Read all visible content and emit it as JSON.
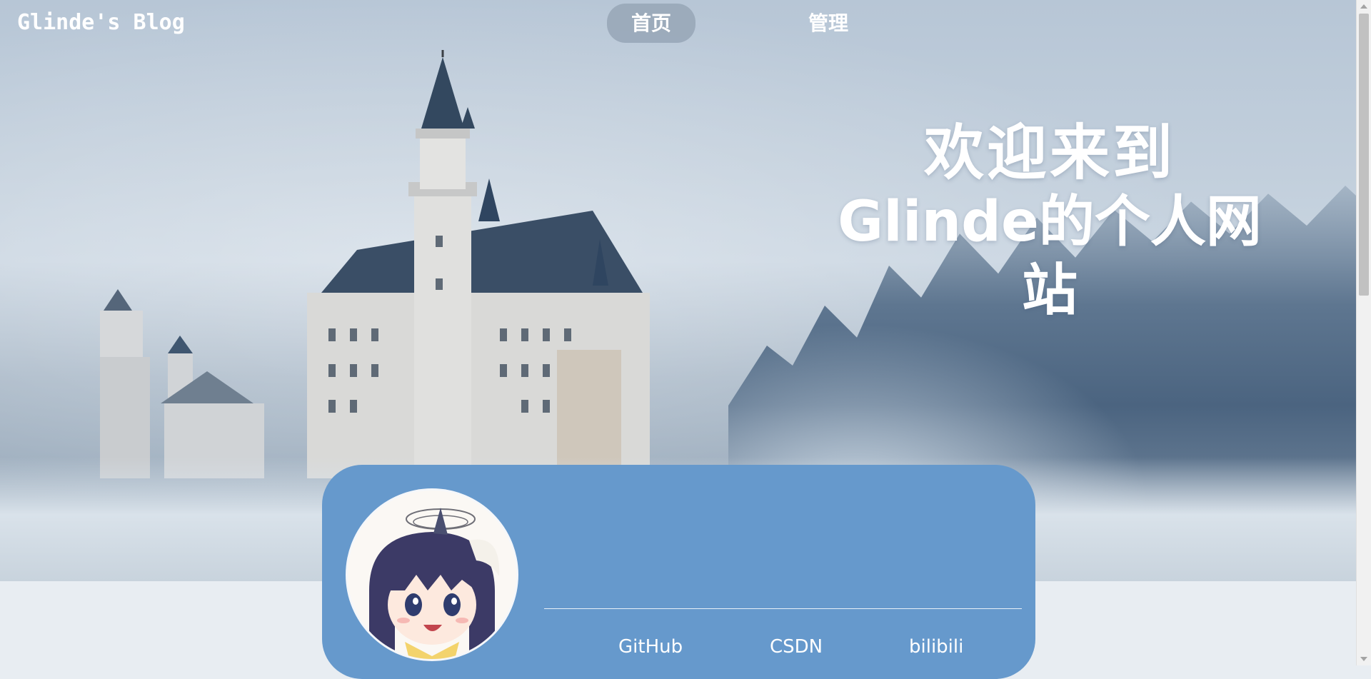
{
  "header": {
    "logo_text": "Glinde's Blog",
    "nav": [
      {
        "label": "首页",
        "active": true
      },
      {
        "label": "管理",
        "active": false
      }
    ]
  },
  "hero": {
    "welcome_line1": "欢迎来到",
    "welcome_line2": "Glinde的个人网站",
    "background_image": "winter-castle-forest"
  },
  "profile_card": {
    "avatar_icon": "anime-girl-avatar",
    "links": [
      {
        "label": "GitHub"
      },
      {
        "label": "CSDN"
      },
      {
        "label": "bilibili"
      }
    ]
  },
  "colors": {
    "card": "#6699cc",
    "nav_active_bg": "#96a6b6",
    "page_bg": "#e8edf2",
    "text": "#ffffff"
  }
}
